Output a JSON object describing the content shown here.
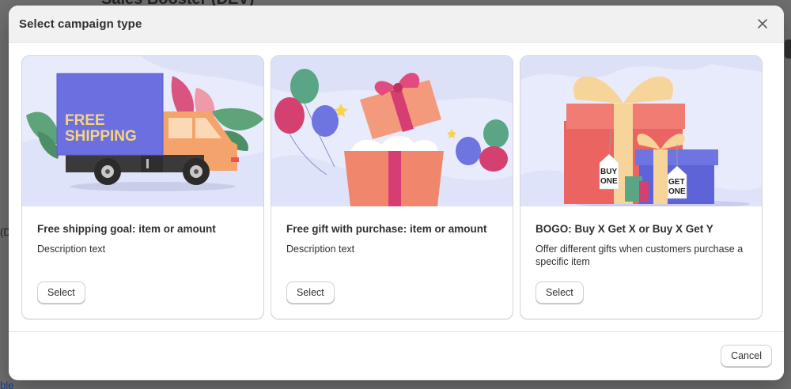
{
  "background": {
    "title": "Sales Booster (DEV)",
    "left_fragment": "(D",
    "bottom_fragment": "ble"
  },
  "modal": {
    "title": "Select campaign type",
    "close_label": "×",
    "cancel_label": "Cancel"
  },
  "cards": [
    {
      "title": "Free shipping goal: item or amount",
      "description": "Description text",
      "select_label": "Select",
      "illustration": {
        "name": "free-shipping-truck-illustration",
        "truck_text_1": "FREE",
        "truck_text_2": "SHIPPING"
      }
    },
    {
      "title": "Free gift with purchase: item or amount",
      "description": "Description text",
      "select_label": "Select",
      "illustration": {
        "name": "gift-box-balloons-illustration"
      }
    },
    {
      "title": "BOGO: Buy X Get X or Buy X Get Y",
      "description": "Offer different gifts when customers purchase a specific item",
      "select_label": "Select",
      "illustration": {
        "name": "bogo-gifts-illustration",
        "tag_1_line_1": "BUY",
        "tag_1_line_2": "ONE",
        "tag_2_line_1": "GET",
        "tag_2_line_2": "ONE"
      }
    }
  ],
  "colors": {
    "illustration_bg": "#e8ebfb",
    "truck_cargo": "#6b6fe0",
    "truck_text": "#f6d57b",
    "gift_box": "#f0876c",
    "ribbon": "#d63d72"
  }
}
